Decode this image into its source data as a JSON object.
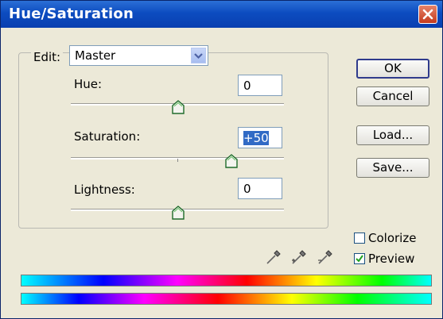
{
  "window": {
    "title": "Hue/Saturation"
  },
  "edit": {
    "label": "Edit:",
    "selected": "Master"
  },
  "sliders": [
    {
      "label": "Hue:",
      "value": "0",
      "level": 0.5
    },
    {
      "label": "Saturation:",
      "value": "+50",
      "level": 0.75,
      "selected": true
    },
    {
      "label": "Lightness:",
      "value": "0",
      "level": 0.5
    }
  ],
  "buttons": {
    "ok": "OK",
    "cancel": "Cancel",
    "load": "Load...",
    "save": "Save..."
  },
  "checkboxes": {
    "colorize": {
      "label": "Colorize",
      "checked": false
    },
    "preview": {
      "label": "Preview",
      "checked": true
    }
  },
  "icons": [
    "close-icon",
    "dropdown-arrow-icon",
    "eyedropper-icon",
    "eyedropper-plus-icon",
    "eyedropper-minus-icon",
    "checkmark-icon"
  ]
}
